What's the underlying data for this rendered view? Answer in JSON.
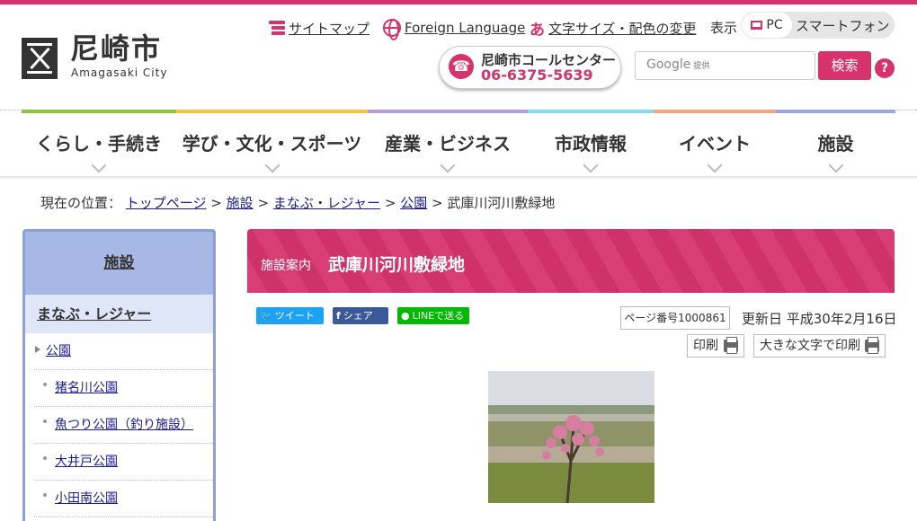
{
  "header": {
    "logo_ja": "尼崎市",
    "logo_en": "Amagasaki City",
    "links": {
      "sitemap": "サイトマップ",
      "foreign": "Foreign Language",
      "fontsize": "文字サイズ・配色の変更",
      "fontsize_icon": "あ"
    },
    "display": {
      "label": "表示",
      "pc": "PC",
      "smartphone": "スマートフォン"
    },
    "call_center": {
      "name": "尼崎市コールセンター",
      "tel": "06-6375-5639"
    },
    "search": {
      "google": "Google",
      "provided": "提供",
      "button": "検索",
      "help": "?"
    }
  },
  "global_nav": [
    {
      "label": "くらし・手続き",
      "color": "#8cc63f"
    },
    {
      "label": "学び・文化・スポーツ",
      "color": "#f5c242"
    },
    {
      "label": "産業・ビジネス",
      "color": "#b39ddb"
    },
    {
      "label": "市政情報",
      "color": "#80deea"
    },
    {
      "label": "イベント",
      "color": "#f4a582"
    },
    {
      "label": "施設",
      "color": "#9fa8da"
    }
  ],
  "breadcrumb": {
    "prefix": "現在の位置：",
    "items": [
      "トップページ",
      "施設",
      "まなぶ・レジャー",
      "公園"
    ],
    "current": "武庫川河川敷緑地",
    "separator": ">"
  },
  "sidebar": {
    "title": "施設",
    "subtitle": "まなぶ・レジャー",
    "items": [
      {
        "label": "公園",
        "level": 1
      },
      {
        "label": "猪名川公園",
        "level": 2
      },
      {
        "label": "魚つり公園（釣り施設）",
        "level": 2
      },
      {
        "label": "大井戸公園",
        "level": 2
      },
      {
        "label": "小田南公園",
        "level": 2
      }
    ]
  },
  "main": {
    "category": "施設案内",
    "title": "武庫川河川敷緑地",
    "sns": {
      "tweet": "ツイート",
      "share": "シェア",
      "line": "LINEで送る"
    },
    "page_number": "ページ番号1000861",
    "updated": "更新日 平成30年2月16日",
    "print": "印刷",
    "print_large": "大きな文字で印刷"
  },
  "colors": {
    "accent": "#d6336c",
    "sidebar": "#8aa0d6",
    "twitter": "#1da1f2",
    "facebook": "#3b5998",
    "line": "#00b900"
  }
}
